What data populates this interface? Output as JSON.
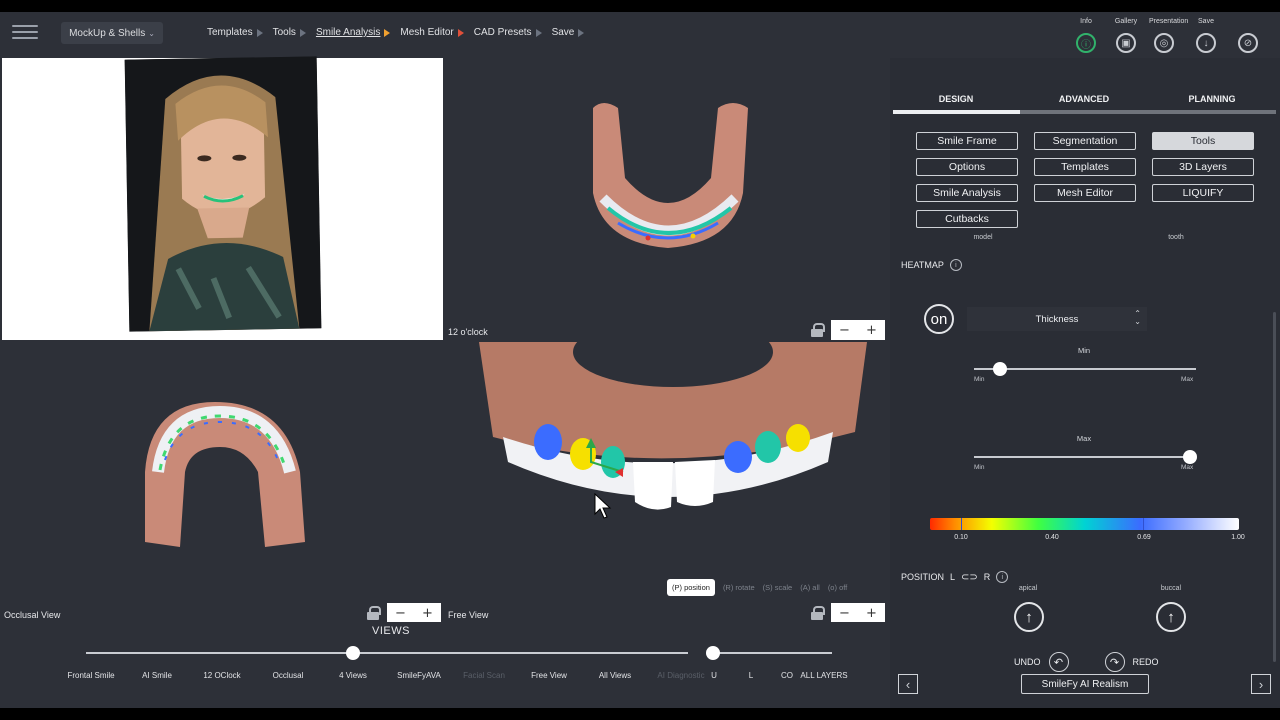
{
  "topbar": {
    "mockup_label": "MockUp & Shells",
    "nav": [
      {
        "label": "Templates",
        "arrow": "gray"
      },
      {
        "label": "Tools",
        "arrow": "gray"
      },
      {
        "label": "Smile Analysis",
        "arrow": "orange",
        "active": true
      },
      {
        "label": "Mesh Editor",
        "arrow": "red"
      },
      {
        "label": "CAD Presets",
        "arrow": "gray"
      },
      {
        "label": "Save",
        "arrow": "gray"
      }
    ],
    "icons": [
      {
        "label": "Info",
        "icon": "info-icon"
      },
      {
        "label": "Gallery",
        "icon": "gallery-icon"
      },
      {
        "label": "Presentation",
        "icon": "presentation-icon"
      },
      {
        "label": "Save",
        "icon": "download-icon"
      },
      {
        "label": "",
        "icon": "eye-hide-icon"
      }
    ]
  },
  "viewports": {
    "top_right_label": "12 o'clock",
    "bottom_left_label": "Occlusal View",
    "bottom_right_label": "Free View",
    "tool_pills": [
      "(P) position",
      "(R) rotate",
      "(S) scale",
      "(A) all",
      "(o) off"
    ]
  },
  "views": {
    "title": "VIEWS",
    "labels": [
      "Frontal Smile",
      "AI Smile",
      "12 OClock",
      "Occlusal",
      "4 Views",
      "SmileFyAVA",
      "Facial Scan",
      "Free View",
      "All Views",
      "AI Diagnostic",
      "U",
      "L",
      "CO",
      "ALL LAYERS"
    ]
  },
  "panel": {
    "tabs": [
      "DESIGN",
      "ADVANCED",
      "PLANNING"
    ],
    "buttons": [
      [
        "Smile Frame",
        "Segmentation",
        "Tools"
      ],
      [
        "Options",
        "Templates",
        "3D Layers"
      ],
      [
        "Smile Analysis",
        "Mesh Editor",
        "LIQUIFY"
      ],
      [
        "Cutbacks"
      ]
    ],
    "under_labels": [
      "model",
      "tooth"
    ],
    "heatmap_title": "HEATMAP",
    "heatmap_toggle": "on",
    "heatmap_mode": "Thickness",
    "min_slider": {
      "title": "Min",
      "start": "Min",
      "end": "Max"
    },
    "max_slider": {
      "title": "Max",
      "start": "Min",
      "end": "Max"
    },
    "colorbar_ticks": [
      "0.10",
      "0.40",
      "0.69",
      "1.00"
    ],
    "position_title": "POSITION",
    "position_l": "L",
    "position_r": "R",
    "apical": "apical",
    "buccal": "buccal",
    "undo": "UNDO",
    "redo": "REDO",
    "ai_realism": "SmileFy AI Realism"
  },
  "colors": {
    "accent_green": "#31b26b",
    "panel_bg": "#2a2d35",
    "app_bg": "#2d3038"
  }
}
